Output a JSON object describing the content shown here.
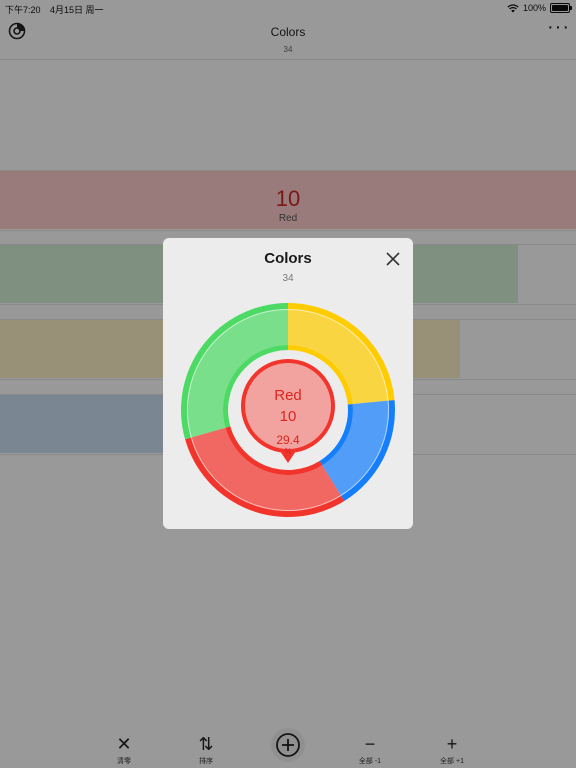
{
  "status_bar": {
    "time": "下午7:20",
    "date": "4月15日 周一",
    "battery": "100%",
    "battery_level": 1.0,
    "icons": [
      "wifi-icon",
      "battery-icon"
    ]
  },
  "nav": {
    "title": "Colors",
    "subtitle": "34",
    "left_icon": "chart-icon",
    "more_icon": "more-icon"
  },
  "list": {
    "red_row": {
      "count": "10",
      "label": "Red"
    }
  },
  "toolbar": {
    "items": [
      {
        "icon": "clear-icon",
        "label": "清零"
      },
      {
        "icon": "sort-icon",
        "label": "排序"
      },
      {
        "icon": "add-circle-icon",
        "label": ""
      },
      {
        "icon": "minus-icon",
        "label": "全部 -1"
      },
      {
        "icon": "plus-icon",
        "label": "全部 +1"
      }
    ]
  },
  "modal": {
    "title": "Colors",
    "subtitle": "34",
    "close_icon": "close-icon"
  },
  "colors": {
    "red": "#f2352c",
    "green": "#4cd964",
    "yellow": "#ffcc00",
    "blue": "#157efb"
  },
  "chart_data": {
    "type": "pie",
    "title": "Colors",
    "subtitle": "34",
    "total": 34,
    "slices": [
      {
        "name": "Yellow",
        "value": 8,
        "color": "#ffcc00"
      },
      {
        "name": "Blue",
        "value": 6,
        "color": "#157efb"
      },
      {
        "name": "Red",
        "value": 10,
        "color": "#f2352c"
      },
      {
        "name": "Green",
        "value": 10,
        "color": "#4cd964"
      }
    ],
    "callout": {
      "label": "Red",
      "value": "10",
      "percent": "29.4",
      "percent_unit": "%"
    }
  }
}
